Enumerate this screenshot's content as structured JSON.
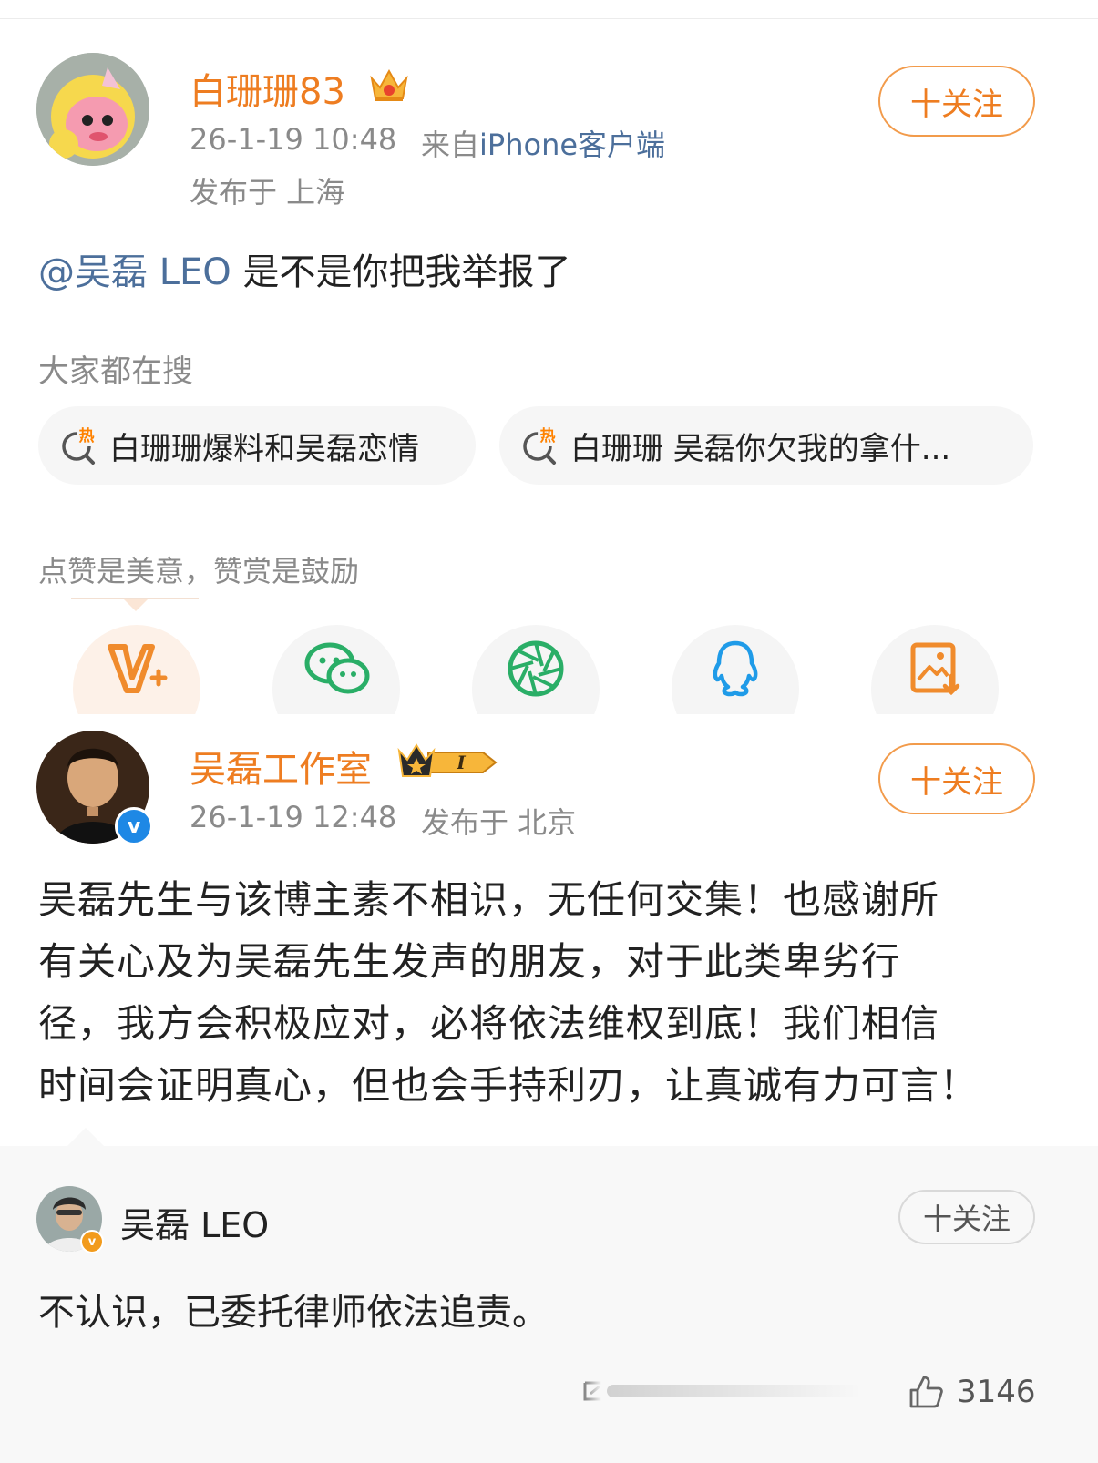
{
  "post1": {
    "username": "白珊珊83",
    "timestamp": "26-1-19 10:48",
    "source_prefix": "来自",
    "source_device": "iPhone客户端",
    "location": "发布于 上海",
    "follow_label": "十关注",
    "mention": "@吴磊 LEO",
    "text": " 是不是你把我举报了"
  },
  "hot_search": {
    "label": "大家都在搜",
    "icon_char": "热",
    "items": [
      {
        "text": "白珊珊爆料和吴磊恋情"
      },
      {
        "text": "白珊珊 吴磊你欠我的拿什..."
      }
    ]
  },
  "reward": {
    "label": "点赞是美意，赞赏是鼓励",
    "icons": [
      "v-plus-icon",
      "wechat-icon",
      "moments-icon",
      "qq-icon",
      "save-image-icon"
    ]
  },
  "post2": {
    "username": "吴磊工作室",
    "level_badge": "I",
    "timestamp": "26-1-19 12:48",
    "location": "发布于 北京",
    "follow_label": "十关注",
    "paragraph": [
      "吴磊先生与该博主素不相识，无任何交集！也感谢所",
      "有关心及为吴磊先生发声的朋友，对于此类卑劣行",
      "径，我方会积极应对，必将依法维权到底！我们相信",
      "时间会证明真心，但也会手持利刃，让真诚有力可言！"
    ]
  },
  "quote": {
    "username": "吴磊 LEO",
    "follow_label": "十关注",
    "text": "不认识，已委托律师依法追责。",
    "like_count": "3146"
  },
  "colors": {
    "orange": "#ee7d21",
    "mention_blue": "#4c6f9b",
    "verified_blue": "#1e88e5",
    "hot_orange": "#ff8200",
    "wechat_green": "#2aae67",
    "qq_blue": "#1f9be8"
  }
}
